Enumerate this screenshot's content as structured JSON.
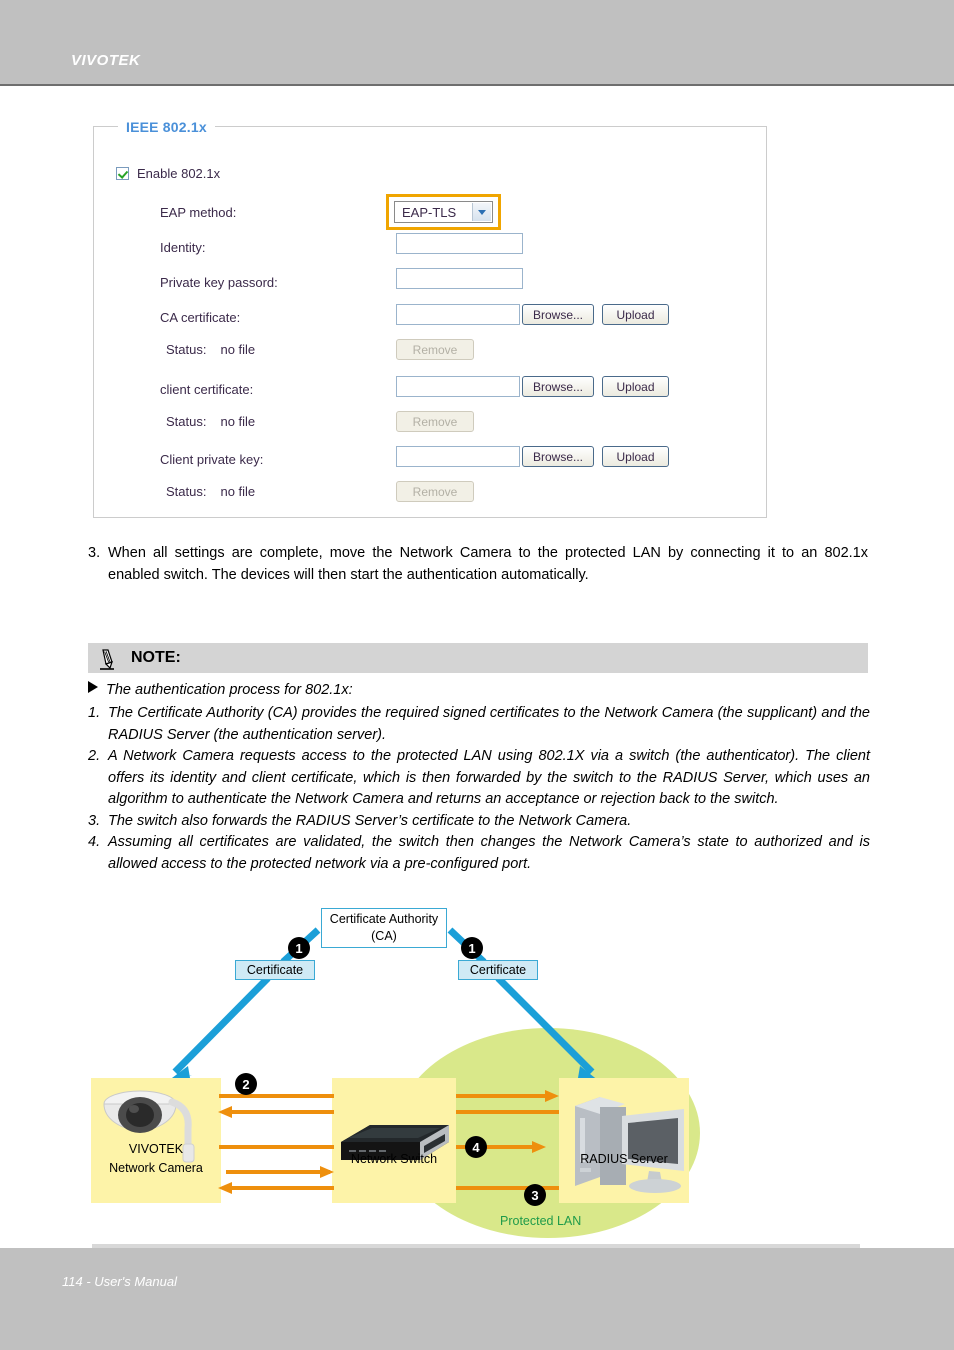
{
  "header": {
    "brand": "VIVOTEK"
  },
  "footer": {
    "text": "114 - User's Manual"
  },
  "form": {
    "legend": "IEEE 802.1x",
    "enable_label": "Enable 802.1x",
    "eap_method_label": "EAP method:",
    "eap_method_value": "EAP-TLS",
    "identity_label": "Identity:",
    "identity_value": "",
    "private_key_password_label": "Private key passord:",
    "private_key_password_value": "",
    "ca_certificate_label": "CA certificate:",
    "ca_certificate_value": "",
    "ca_status_label": "Status:",
    "ca_status_value": "no file",
    "client_certificate_label": "client certificate:",
    "client_certificate_value": "",
    "client_status_label": "Status:",
    "client_status_value": "no file",
    "client_private_key_label": "Client private key:",
    "client_private_key_value": "",
    "key_status_label": "Status:",
    "key_status_value": "no file",
    "browse_label": "Browse...",
    "upload_label": "Upload",
    "remove_label": "Remove",
    "accent_orange": "#f0a500",
    "legend_blue": "#4a90d9"
  },
  "step3": {
    "number": "3.",
    "text": "When all settings are complete, move the Network Camera to the protected LAN by connecting it to an 802.1x enabled switch. The devices will then start the authentication automatically."
  },
  "note": {
    "title": "NOTE:",
    "intro": "The authentication process for 802.1x:",
    "items": [
      {
        "number": "1.",
        "text": "The Certificate Authority (CA) provides the required signed certificates to the Network Camera (the supplicant) and the RADIUS Server (the authentication server)."
      },
      {
        "number": "2.",
        "text": "A Network Camera requests access to the protected LAN using 802.1X via a switch (the authenticator). The client offers its identity and client certificate, which is then forwarded by the switch to the RADIUS Server, which uses an algorithm to authenticate the Network Camera and returns an acceptance or rejection back to the switch."
      },
      {
        "number": "3.",
        "text": "The switch also forwards the RADIUS Server’s certificate to the Network Camera."
      },
      {
        "number": "4.",
        "text": "Assuming all certificates are validated, the switch then changes the Network Camera’s state to authorized and is allowed access to the protected network via a pre-configured port."
      }
    ]
  },
  "diagram": {
    "ca_title": "Certificate Authority",
    "ca_subtitle": "(CA)",
    "certificate_left_label": "Certificate",
    "certificate_right_label": "Certificate",
    "badge_1a": "1",
    "badge_1b": "1",
    "badge_2": "2",
    "badge_3": "3",
    "badge_4": "4",
    "camera_label_line1": "VIVOTEK",
    "camera_label_line2": "Network Camera",
    "switch_label": "Network Switch",
    "server_label": "RADIUS Server",
    "protected_lan_label": "Protected LAN",
    "colors": {
      "device_box": "#fdf3a8",
      "protected_lan": "#d9e88a",
      "blue_arrow": "#1b9fd8",
      "orange_arrow": "#ee8f0d",
      "lan_text": "#1f9b4a"
    }
  }
}
